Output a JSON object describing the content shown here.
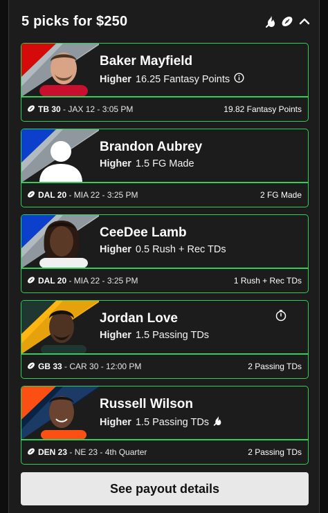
{
  "header": {
    "title": "5 picks for $250",
    "icons": [
      "flame-icon",
      "football-icon",
      "chevron-up-icon"
    ]
  },
  "picks": [
    {
      "player": "Baker Mayfield",
      "direction": "Higher",
      "line": "16.25 Fantasy Points",
      "extra_icon": "info-icon",
      "home": "TB 30",
      "matchup": " - JAX 12 - 3:05 PM",
      "result": "19.82 Fantasy Points",
      "team_colors": [
        "#d50a0a",
        "#b1babf"
      ]
    },
    {
      "player": "Brandon Aubrey",
      "direction": "Higher",
      "line": "1.5 FG Made",
      "extra_icon": "",
      "home": "DAL 20",
      "matchup": " - MIA 22 - 3:25 PM",
      "result": "2 FG Made",
      "team_colors": [
        "#0b3fcc",
        "#b1babf"
      ]
    },
    {
      "player": "CeeDee Lamb",
      "direction": "Higher",
      "line": "0.5 Rush + Rec TDs",
      "extra_icon": "",
      "home": "DAL 20",
      "matchup": " - MIA 22 - 3:25 PM",
      "result": "1 Rush + Rec TDs",
      "team_colors": [
        "#0b3fcc",
        "#b1babf"
      ]
    },
    {
      "player": "Jordan Love",
      "direction": "Higher",
      "line": "1.5 Passing TDs",
      "extra_icon": "stopwatch-icon",
      "home": "GB 33",
      "matchup": " - CAR 30 - 12:00 PM",
      "result": "2 Passing TDs",
      "team_colors": [
        "#203731",
        "#ffb612"
      ]
    },
    {
      "player": "Russell Wilson",
      "direction": "Higher",
      "line": "1.5 Passing TDs",
      "extra_icon": "flame-icon",
      "home": "DEN 23",
      "matchup": " - NE 23 - 4th Quarter",
      "result": "2 Passing TDs",
      "team_colors": [
        "#fb4f14",
        "#0a2343"
      ]
    }
  ],
  "footer": {
    "payout_label": "See payout details"
  }
}
